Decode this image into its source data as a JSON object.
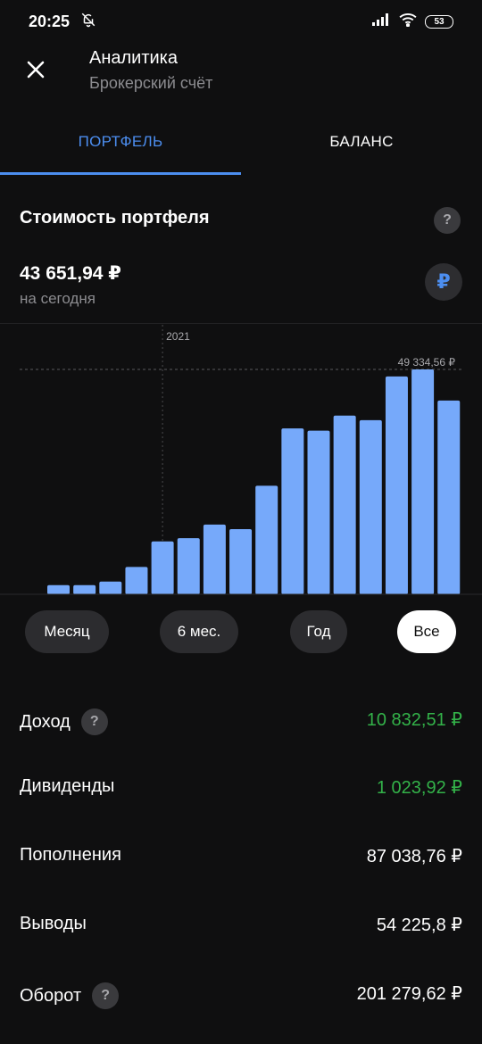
{
  "status_bar": {
    "time": "20:25",
    "battery": "53"
  },
  "header": {
    "title": "Аналитика",
    "subtitle": "Брокерский счёт"
  },
  "tabs": [
    {
      "label": "ПОРТФЕЛЬ",
      "active": true
    },
    {
      "label": "БАЛАНС",
      "active": false
    }
  ],
  "portfolio": {
    "title": "Стоимость портфеля",
    "value": "43 651,94 ₽",
    "caption": "на сегодня",
    "currency_symbol": "₽"
  },
  "chart_data": {
    "type": "bar",
    "year_marker": "2021",
    "max_label": "49 334,56 ₽",
    "values": [
      2000,
      2000,
      2800,
      6000,
      11600,
      12300,
      15300,
      14300,
      23800,
      36400,
      35900,
      39200,
      38200,
      47800,
      49334.56,
      42500
    ],
    "ylim": [
      0,
      49334.56
    ],
    "bar_color": "#76a9fa",
    "year_marker_index": 4
  },
  "periods": [
    {
      "label": "Месяц",
      "selected": false
    },
    {
      "label": "6 мес.",
      "selected": false
    },
    {
      "label": "Год",
      "selected": false
    },
    {
      "label": "Все",
      "selected": true
    }
  ],
  "stats": [
    {
      "label": "Доход",
      "value": "10 832,51 ₽",
      "green": true,
      "help": true
    },
    {
      "label": "Дивиденды",
      "value": "1 023,92 ₽",
      "green": true,
      "help": false
    },
    {
      "label": "Пополнения",
      "value": "87 038,76 ₽",
      "green": false,
      "help": false
    },
    {
      "label": "Выводы",
      "value": "54 225,8 ₽",
      "green": false,
      "help": false
    },
    {
      "label": "Оборот",
      "value": "201 279,62 ₽",
      "green": false,
      "help": true
    }
  ],
  "colors": {
    "accent": "#4c8ef0",
    "positive": "#33b249",
    "background": "#0f0f10"
  }
}
